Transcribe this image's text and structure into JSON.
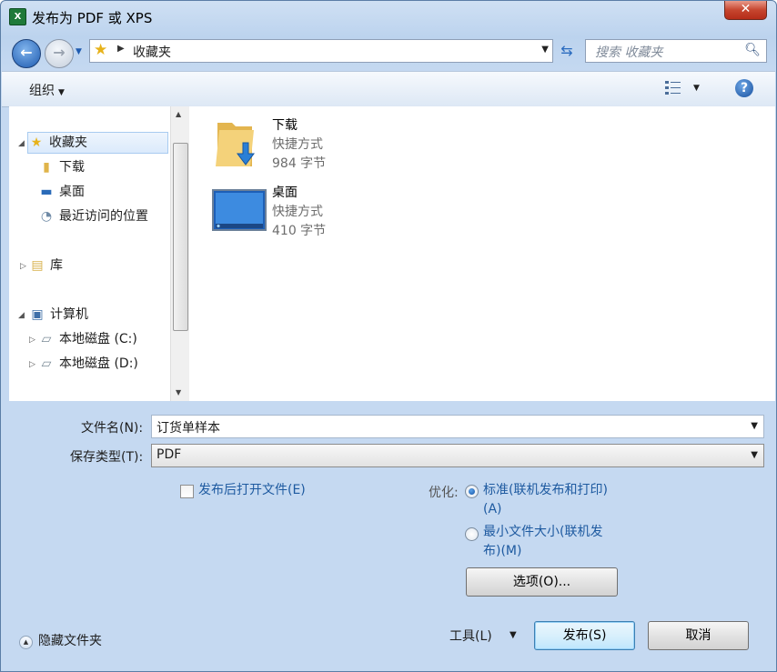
{
  "window": {
    "title": "发布为 PDF 或 XPS",
    "close_label": "✕"
  },
  "address": {
    "path": "收藏夹",
    "search_placeholder": "搜索 收藏夹"
  },
  "toolbar": {
    "organize_label": "组织",
    "help_label": "?"
  },
  "nav": {
    "favorites": "收藏夹",
    "downloads": "下载",
    "desktop": "桌面",
    "recent": "最近访问的位置",
    "libraries": "库",
    "computer": "计算机",
    "drive_c": "本地磁盘 (C:)",
    "drive_d": "本地磁盘 (D:)"
  },
  "files": [
    {
      "name": "下载",
      "type": "快捷方式",
      "size": "984 字节",
      "icon": "folder-download-icon"
    },
    {
      "name": "桌面",
      "type": "快捷方式",
      "size": "410 字节",
      "icon": "desktop-icon"
    }
  ],
  "form": {
    "filename_label": "文件名(N):",
    "filename_value": "订货单样本",
    "filetype_label": "保存类型(T):",
    "filetype_value": "PDF",
    "open_after_label": "发布后打开文件(E)",
    "optimize_label": "优化:",
    "opt_standard_line1": "标准(联机发布和打印)",
    "opt_standard_line2": "(A)",
    "opt_minimum_line1": "最小文件大小(联机发",
    "opt_minimum_line2": "布)(M)",
    "options_button": "选项(O)..."
  },
  "footer": {
    "hide_folders": "隐藏文件夹",
    "tools": "工具(L)",
    "publish": "发布(S)",
    "cancel": "取消"
  }
}
